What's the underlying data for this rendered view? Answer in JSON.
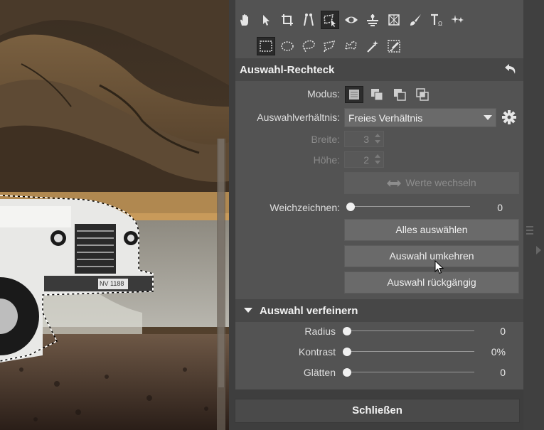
{
  "section_selection": {
    "title": "Auswahl-Rechteck"
  },
  "mode": {
    "label": "Modus:"
  },
  "ratio": {
    "label": "Auswahlverhältnis:",
    "value": "Freies Verhältnis"
  },
  "width": {
    "label": "Breite:",
    "value": "3"
  },
  "height": {
    "label": "Höhe:",
    "value": "2"
  },
  "swap_button": "Werte wechseln",
  "feather": {
    "label": "Weichzeichnen:",
    "value": "0"
  },
  "buttons": {
    "select_all": "Alles auswählen",
    "invert": "Auswahl umkehren",
    "undo": "Auswahl rückgängig"
  },
  "section_refine": {
    "title": "Auswahl verfeinern"
  },
  "refine": {
    "radius": {
      "label": "Radius",
      "value": "0"
    },
    "contrast": {
      "label": "Kontrast",
      "value": "0%"
    },
    "smooth": {
      "label": "Glätten",
      "value": "0"
    }
  },
  "close_button": "Schließen",
  "photo": {
    "plate_text": "NV 1188"
  },
  "colors": {
    "panel": "#535353",
    "header": "#474747",
    "button": "#6a6a6a",
    "background": "#3e3e3e"
  }
}
